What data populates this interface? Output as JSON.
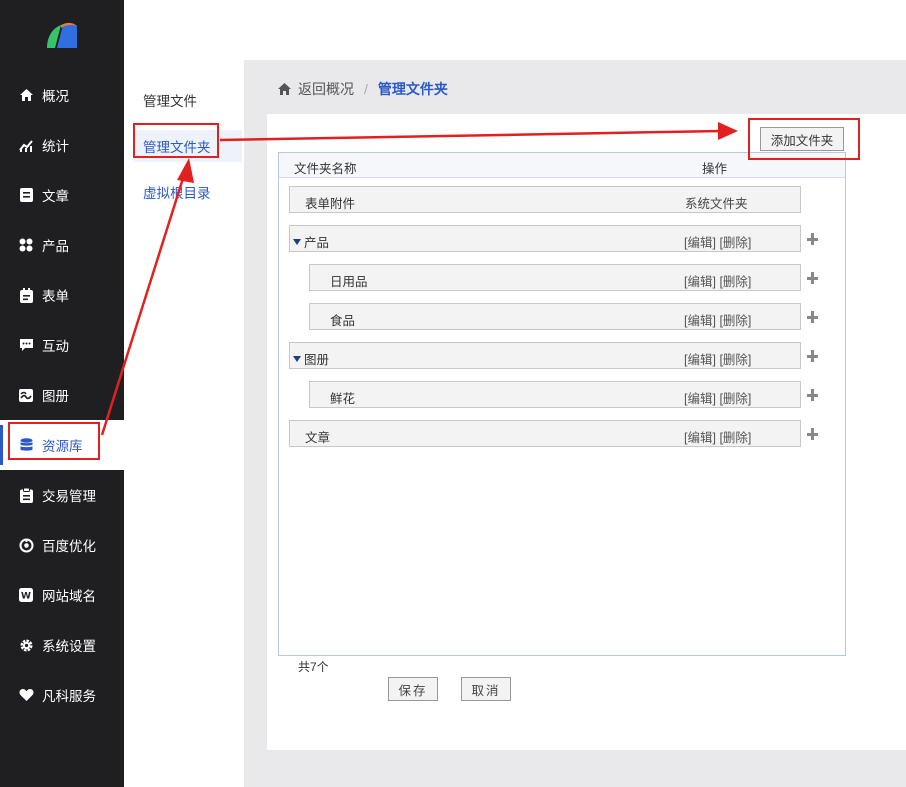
{
  "sidebar": {
    "items": [
      {
        "label": "概况",
        "icon": "home-icon"
      },
      {
        "label": "统计",
        "icon": "chart-icon"
      },
      {
        "label": "文章",
        "icon": "article-icon"
      },
      {
        "label": "产品",
        "icon": "grid-icon"
      },
      {
        "label": "表单",
        "icon": "form-icon"
      },
      {
        "label": "互动",
        "icon": "chat-icon"
      },
      {
        "label": "图册",
        "icon": "gallery-icon"
      },
      {
        "label": "资源库",
        "icon": "database-icon"
      },
      {
        "label": "交易管理",
        "icon": "trade-icon"
      },
      {
        "label": "百度优化",
        "icon": "seo-icon"
      },
      {
        "label": "网站域名",
        "icon": "domain-icon"
      },
      {
        "label": "系统设置",
        "icon": "gear-icon"
      },
      {
        "label": "凡科服务",
        "icon": "heart-icon"
      }
    ]
  },
  "subnav": {
    "manage_files": "管理文件",
    "manage_folders": "管理文件夹",
    "virtual_dir": "虚拟根目录"
  },
  "breadcrumb": {
    "back": "返回概况",
    "separator": "/",
    "current": "管理文件夹"
  },
  "toolbar": {
    "add_folder": "添加文件夹"
  },
  "table": {
    "col_name": "文件夹名称",
    "col_ops": "操作",
    "rows": [
      {
        "name": "表单附件",
        "ops": "系统文件夹"
      },
      {
        "name": "产品",
        "edit": "[编辑]",
        "del": "[删除]"
      },
      {
        "name": "日用品",
        "edit": "[编辑]",
        "del": "[删除]"
      },
      {
        "name": "食品",
        "edit": "[编辑]",
        "del": "[删除]"
      },
      {
        "name": "图册",
        "edit": "[编辑]",
        "del": "[删除]"
      },
      {
        "name": "鲜花",
        "edit": "[编辑]",
        "del": "[删除]"
      },
      {
        "name": "文章",
        "edit": "[编辑]",
        "del": "[删除]"
      }
    ]
  },
  "footer": {
    "total": "共7个",
    "save": "保存",
    "cancel": "取消"
  },
  "colors": {
    "accent": "#2d59c7",
    "sidebar_bg": "#1f1f22",
    "annotation": "#e32020"
  }
}
